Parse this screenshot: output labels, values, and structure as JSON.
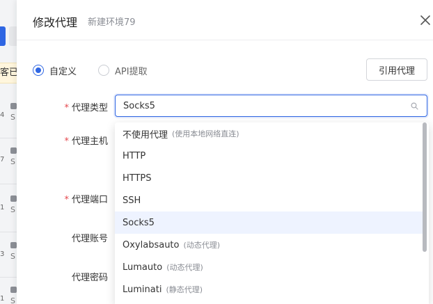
{
  "background": {
    "notice_fragment": "客已选",
    "row_numbers": [
      "4",
      "7",
      "1",
      "3",
      "1"
    ],
    "row_letter": "S"
  },
  "modal": {
    "title": "修改代理",
    "subtitle": "新建环境79",
    "close_icon": "close-icon"
  },
  "source": {
    "options": [
      {
        "label": "自定义",
        "checked": true
      },
      {
        "label": "API提取",
        "checked": false
      }
    ],
    "cite_button": "引用代理"
  },
  "form": {
    "type_label": "代理类型",
    "host_label": "代理主机",
    "port_label": "代理端口",
    "account_label": "代理账号",
    "password_label": "代理密码",
    "required_mark": "*",
    "type_value": "Socks5"
  },
  "dropdown": {
    "selected": "Socks5",
    "options": [
      {
        "label": "不使用代理",
        "hint": "(使用本地网络直连)"
      },
      {
        "label": "HTTP",
        "hint": ""
      },
      {
        "label": "HTTPS",
        "hint": ""
      },
      {
        "label": "SSH",
        "hint": ""
      },
      {
        "label": "Socks5",
        "hint": ""
      },
      {
        "label": "Oxylabsauto",
        "hint": "(动态代理)"
      },
      {
        "label": "Lumauto",
        "hint": "(动态代理)"
      },
      {
        "label": "Luminati",
        "hint": "(静态代理)"
      }
    ]
  },
  "colors": {
    "accent": "#2f66e3",
    "required": "#e5484d",
    "selected_bg": "#eef3ff"
  }
}
